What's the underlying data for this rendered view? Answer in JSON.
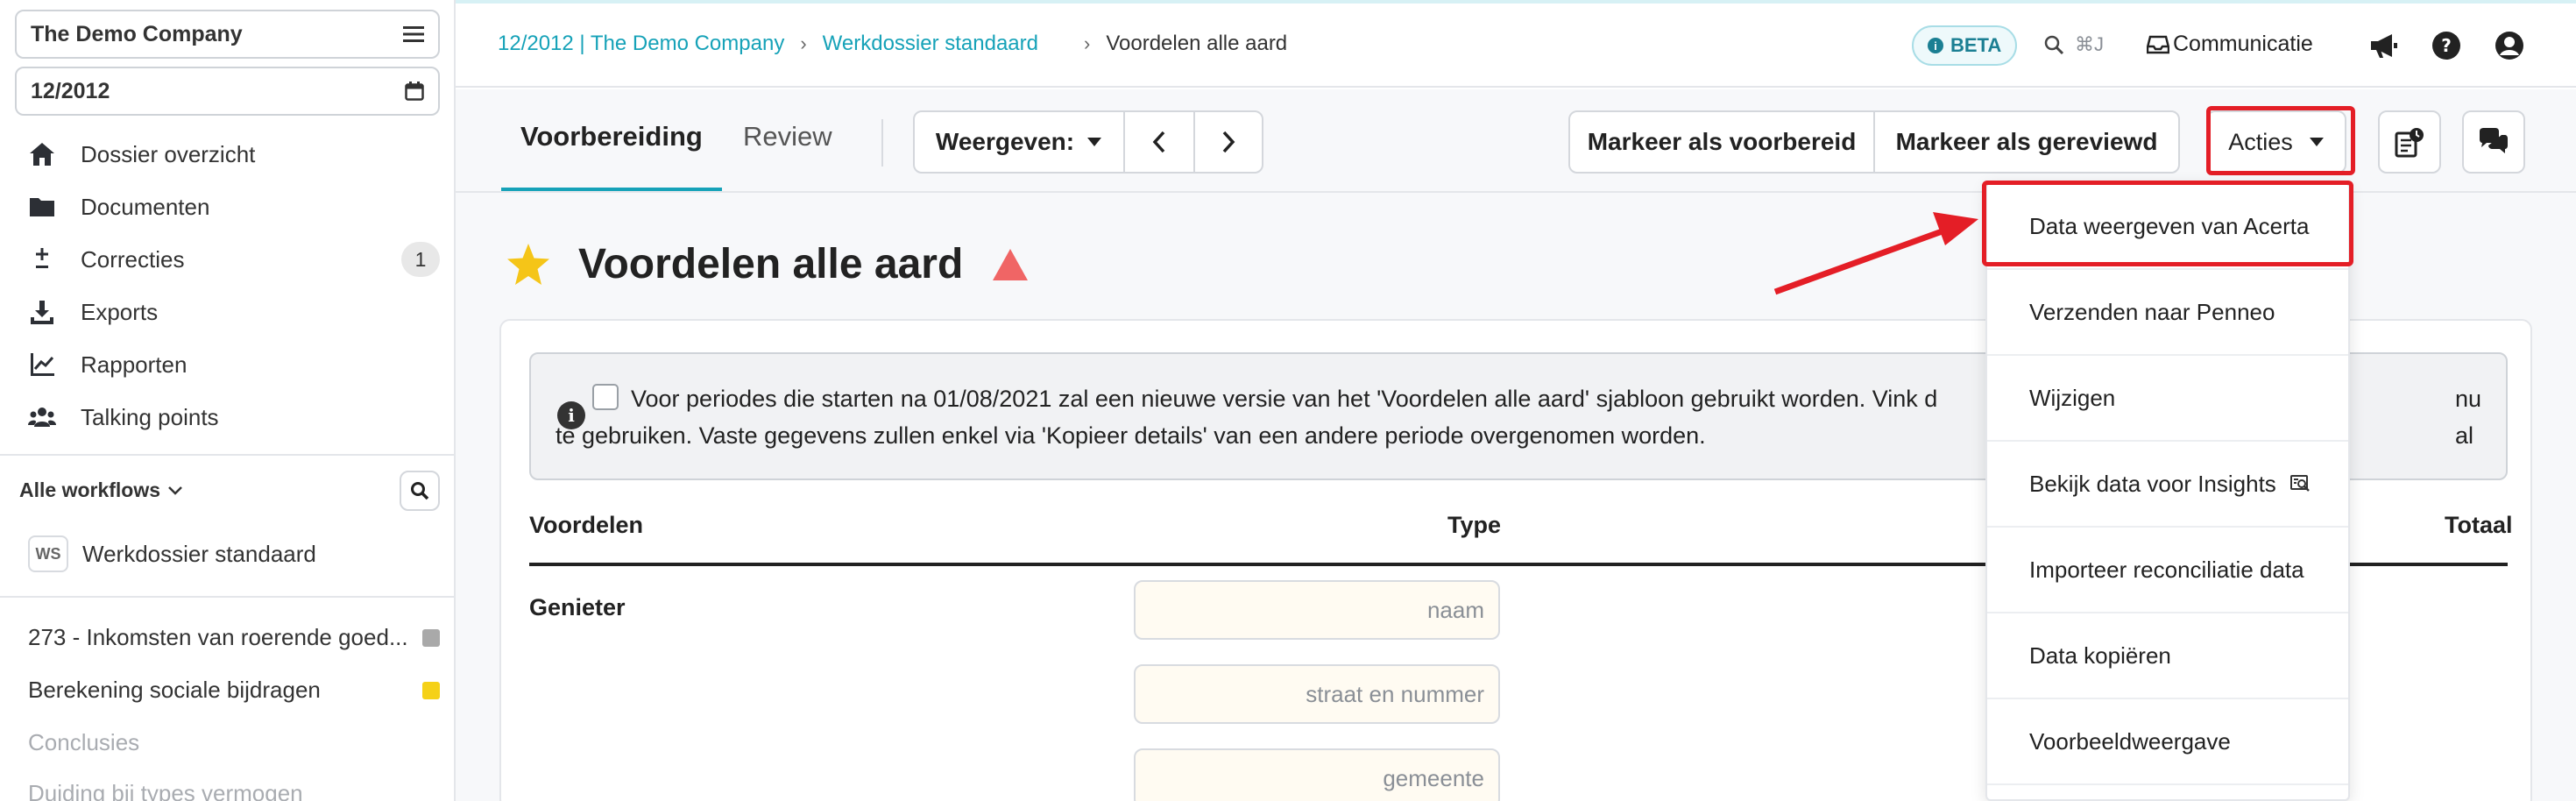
{
  "sidebar": {
    "company": "The Demo Company",
    "period": "12/2012",
    "nav": [
      {
        "label": "Dossier overzicht",
        "icon": "home-icon"
      },
      {
        "label": "Documenten",
        "icon": "folder-icon"
      },
      {
        "label": "Correcties",
        "icon": "plus-minus-icon",
        "badge": "1"
      },
      {
        "label": "Exports",
        "icon": "download-icon"
      },
      {
        "label": "Rapporten",
        "icon": "chart-line-icon"
      },
      {
        "label": "Talking points",
        "icon": "users-icon"
      }
    ],
    "workflows_label": "Alle workflows",
    "workflow": {
      "badge": "WS",
      "label": "Werkdossier standaard"
    },
    "tasks": [
      {
        "label": "273 - Inkomsten van roerende goed...",
        "color": "#a9a9a9"
      },
      {
        "label": "Berekening sociale bijdragen",
        "color": "#f5d117"
      },
      {
        "label": "Conclusies",
        "color": ""
      },
      {
        "label": "Duiding bij types vermogen",
        "color": ""
      }
    ]
  },
  "topbar": {
    "breadcrumb": [
      "12/2012 | The Demo Company",
      "Werkdossier standaard",
      "Voordelen alle aard"
    ],
    "beta": "BETA",
    "shortcut": "⌘J",
    "communicatie": "Communicatie"
  },
  "toolbar": {
    "tabs": [
      "Voorbereiding",
      "Review"
    ],
    "weergeven": "Weergeven:",
    "mark_prepared": "Markeer als voorbereid",
    "mark_reviewed": "Markeer als gereviewd",
    "acties": "Acties"
  },
  "page": {
    "title": "Voordelen alle aard",
    "notice_line1": "Voor periodes die starten na 01/08/2021 zal een nieuwe versie van het 'Voordelen alle aard' sjabloon gebruikt worden. Vink d",
    "notice_line1_end": "nu al",
    "notice_line2": "te gebruiken. Vaste gegevens zullen enkel via 'Kopieer details' van een andere periode overgenomen worden.",
    "table_headers": {
      "voordelen": "Voordelen",
      "type": "Type",
      "totaal": "Totaal"
    },
    "row_label": "Genieter",
    "placeholders": [
      "naam",
      "straat en nummer",
      "gemeente"
    ]
  },
  "dropdown": {
    "items": [
      "Data weergeven van Acerta",
      "Verzenden naar Penneo",
      "Wijzigen",
      "Bekijk data voor Insights",
      "Importeer reconciliatie data",
      "Data kopiëren",
      "Voorbeeldweergave"
    ]
  },
  "colors": {
    "accent": "#16a2b8",
    "highlight": "#e41e26",
    "star": "#f5c518",
    "warning": "#f06565"
  }
}
